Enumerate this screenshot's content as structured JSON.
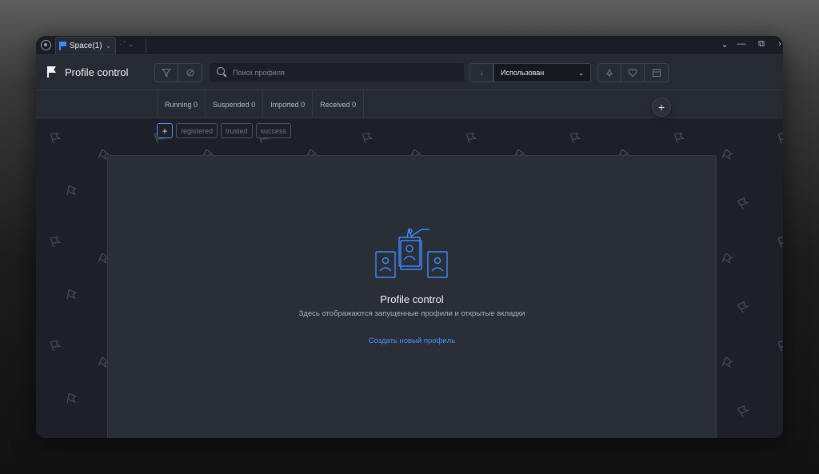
{
  "titlebar": {
    "tab_label": "Space(1)",
    "extra_label": "· ˇ ⌄",
    "controls": [
      "⌄",
      "—",
      "⧉",
      "›"
    ]
  },
  "header": {
    "title": "Profile control",
    "search_placeholder": "Поиск профиля",
    "sort_direction": "↓",
    "sort_value": "Использован",
    "sort_chevron": "⌄"
  },
  "tabs": [
    "Running 0",
    "Suspended 0",
    "Imported 0",
    "Received 0"
  ],
  "tags": {
    "add": "+",
    "items": [
      "registered",
      "trusted",
      "success"
    ]
  },
  "add_button": "+",
  "empty_state": {
    "title": "Profile control",
    "description": "Здесь отображаются запущенные профили и открытые вкладки",
    "link": "Создать новый профиль"
  },
  "colors": {
    "accent": "#4a90ff",
    "background": "#1d2027",
    "panel": "#2a2e36"
  }
}
